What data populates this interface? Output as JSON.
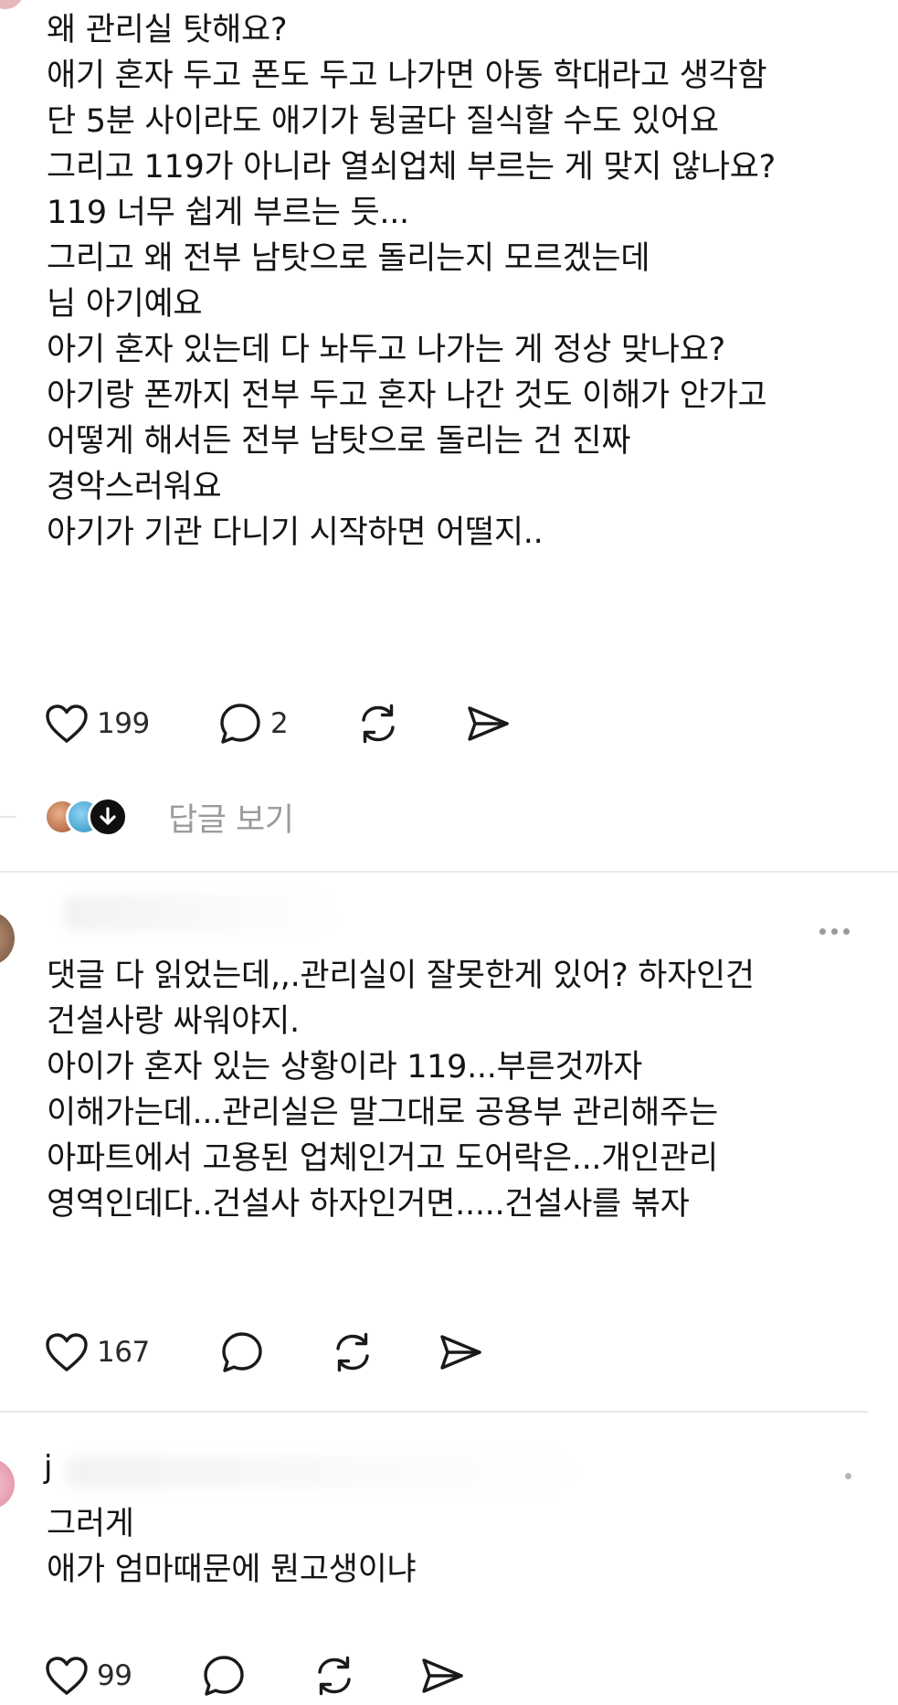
{
  "posts": [
    {
      "lines": [
        "왜 관리실 탓해요?",
        "애기 혼자 두고 폰도 두고 나가면 아동 학대라고 생각함",
        "단 5분 사이라도 애기가 뒹굴다 질식할 수도 있어요",
        "그리고 119가 아니라 열쇠업체 부르는 게 맞지 않나요?",
        "119 너무 쉽게 부르는 듯...",
        "그리고 왜 전부 남탓으로 돌리는지 모르겠는데",
        "님 아기예요",
        "아기 혼자 있는데 다 놔두고 나가는 게 정상 맞나요?",
        "아기랑 폰까지 전부 두고 혼자 나간 것도 이해가 안가고",
        "어떻게 해서든 전부 남탓으로 돌리는 건 진짜",
        "경악스러워요",
        "아기가 기관 다니기 시작하면 어떨지.."
      ],
      "likes": "199",
      "comments": "2",
      "view_replies": "답글 보기"
    },
    {
      "username": "",
      "lines": [
        "댓글 다 읽었는데,,.관리실이 잘못한게 있어? 하자인건",
        "건설사랑 싸워야지.",
        "아이가 혼자 있는 상황이라 119...부른것까자",
        "이해가는데...관리실은 말그대로 공용부 관리해주는",
        "아파트에서 고용된 업체인거고 도어락은...개인관리",
        "영역인데다..건설사 하자인거면.....건설사를 볶자"
      ],
      "likes": "167",
      "comments": ""
    },
    {
      "username": "j",
      "lines": [
        "그러게",
        "애가 엄마때문에 뭔고생이냐"
      ],
      "likes": "99",
      "comments": ""
    }
  ],
  "colors": {
    "text": "#141414",
    "muted": "#9b9b9b",
    "divider": "#e9e9e9",
    "icon": "#1a1a1a"
  }
}
